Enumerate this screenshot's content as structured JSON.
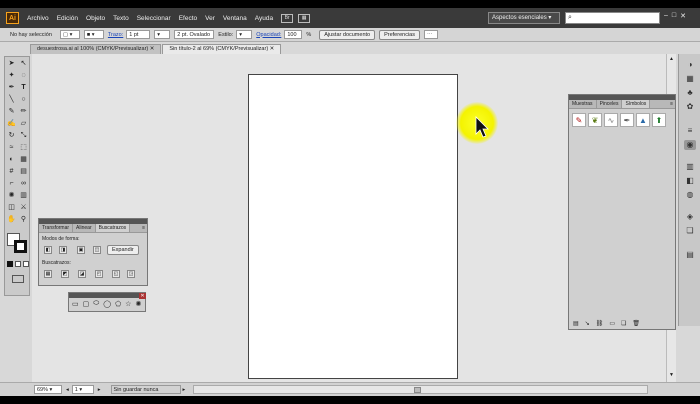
{
  "menubar": {
    "logo": "Ai",
    "items": [
      "Archivo",
      "Edición",
      "Objeto",
      "Texto",
      "Seleccionar",
      "Efecto",
      "Ver",
      "Ventana",
      "Ayuda"
    ],
    "workspace": "Aspectos esenciales",
    "search_placeholder": ""
  },
  "control_bar": {
    "selection_status": "No hay selección",
    "stroke_label": "Trazo:",
    "stroke_value": "1 pt",
    "brush_value": "2 pt. Ovalado",
    "style_label": "Estilo:",
    "opacity_label": "Opacidad:",
    "opacity_value": "100",
    "opacity_unit": "%",
    "fit_doc_button": "Ajustar documento",
    "prefs_button": "Preferencias"
  },
  "tabs": [
    {
      "label": "desuestrosa.ai al 100% (CMYK/Previsualizar)"
    },
    {
      "label": "Sin título-2 al 69% (CMYK/Previsualizar)"
    }
  ],
  "status_bar": {
    "zoom": "69%",
    "artboard_num": "1",
    "status_text": "Sin guardar nunca"
  },
  "pathfinder_panel": {
    "tabs": [
      "Transformar",
      "Alinear",
      "Buscatrazos"
    ],
    "shape_modes_label": "Modos de forma:",
    "expand_button": "Expandir",
    "pathfinders_label": "Buscatrazos:"
  },
  "symbols_panel": {
    "tabs": [
      "Muestras",
      "Pinceles",
      "Símbolos"
    ]
  },
  "colors": {
    "menubar": "#3a3a3a",
    "highlight": "#f4f300",
    "link": "#1a45b8"
  }
}
